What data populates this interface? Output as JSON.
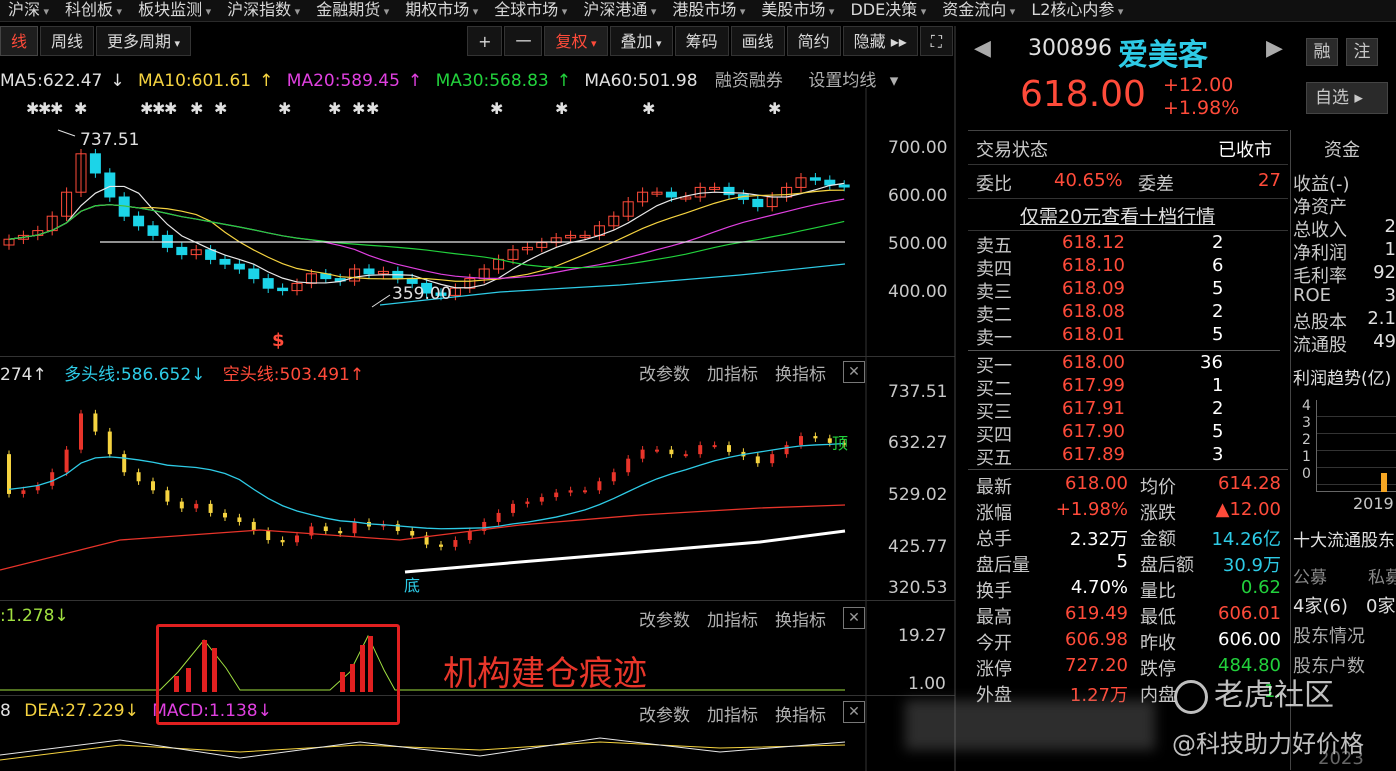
{
  "topnav": [
    "沪深",
    "科创板",
    "板块监测",
    "沪深指数",
    "金融期货",
    "期权市场",
    "全球市场",
    "沪深港通",
    "港股市场",
    "美股市场",
    "DDE决策",
    "资金流向",
    "L2核心内参"
  ],
  "toolbar": {
    "items": [
      "线",
      "周线",
      "更多周期",
      "+",
      "一",
      "复权",
      "叠加",
      "筹码",
      "画线",
      "简约",
      "隐藏"
    ],
    "expand_icon": "expand-icon"
  },
  "ma": {
    "ma5": "MA5:622.47",
    "ma10": "MA10:601.61",
    "ma20": "MA20:589.45",
    "ma30": "MA30:568.83",
    "ma60": "MA60:501.98",
    "margin": "融资融券",
    "settings": "设置均线"
  },
  "main_chart": {
    "high_label": "737.51",
    "low_label": "359.00",
    "dollar": "$",
    "y_labels": [
      "700.00",
      "600.00",
      "500.00",
      "400.00"
    ],
    "stars": [
      "✱✱✱ ✱",
      "✱✱✱ ✱ ✱",
      "✱",
      "✱",
      "✱ ✱✱",
      "✱",
      "✱",
      "✱",
      "✱"
    ]
  },
  "panel2": {
    "left": "274",
    "long_line": "多头线:586.652",
    "short_line": "空头线:503.491",
    "y_labels": [
      "737.51",
      "632.27",
      "529.02",
      "425.77",
      "320.53"
    ],
    "top_mark": "顶",
    "bottom_mark": "底"
  },
  "panel3": {
    "value": ":1.278",
    "y_labels": [
      "19.27",
      "1.00"
    ]
  },
  "panel4": {
    "left": "8",
    "dea": "DEA:27.229",
    "macd": "MACD:1.138"
  },
  "panel_buttons": {
    "params": "改参数",
    "add": "加指标",
    "swap": "换指标",
    "close": "✕"
  },
  "annotation": "机构建仓痕迹",
  "stock": {
    "code": "300896",
    "name": "爱美客",
    "price": "618.00",
    "change": "+12.00",
    "change_pct": "+1.98%",
    "btn_margin": "融",
    "btn_note": "注",
    "btn_watch": "自选"
  },
  "status": {
    "label": "交易状态",
    "value": "已收市"
  },
  "commission": {
    "ratio_label": "委比",
    "ratio": "40.65%",
    "diff_label": "委差",
    "diff": "27"
  },
  "promo": "仅需20元查看十档行情",
  "asks": [
    {
      "label": "卖五",
      "price": "618.12",
      "vol": "2"
    },
    {
      "label": "卖四",
      "price": "618.10",
      "vol": "6"
    },
    {
      "label": "卖三",
      "price": "618.09",
      "vol": "5"
    },
    {
      "label": "卖二",
      "price": "618.08",
      "vol": "2"
    },
    {
      "label": "卖一",
      "price": "618.01",
      "vol": "5"
    }
  ],
  "bids": [
    {
      "label": "买一",
      "price": "618.00",
      "vol": "36"
    },
    {
      "label": "买二",
      "price": "617.99",
      "vol": "1"
    },
    {
      "label": "买三",
      "price": "617.91",
      "vol": "2"
    },
    {
      "label": "买四",
      "price": "617.90",
      "vol": "5"
    },
    {
      "label": "买五",
      "price": "617.89",
      "vol": "3"
    }
  ],
  "quote": [
    {
      "l1": "最新",
      "v1": "618.00",
      "l2": "均价",
      "v2": "614.28"
    },
    {
      "l1": "涨幅",
      "v1": "+1.98%",
      "l2": "涨跌",
      "v2": "▲12.00"
    },
    {
      "l1": "总手",
      "v1": "2.32万",
      "l2": "金额",
      "v2": "14.26亿"
    },
    {
      "l1": "盘后量",
      "v1": "5",
      "l2": "盘后额",
      "v2": "30.9万"
    },
    {
      "l1": "换手",
      "v1": "4.70%",
      "l2": "量比",
      "v2": "0.62"
    },
    {
      "l1": "最高",
      "v1": "619.49",
      "l2": "最低",
      "v2": "606.01"
    },
    {
      "l1": "今开",
      "v1": "606.98",
      "l2": "昨收",
      "v2": "606.00"
    },
    {
      "l1": "涨停",
      "v1": "727.20",
      "l2": "跌停",
      "v2": "484.80"
    },
    {
      "l1": "外盘",
      "v1": "1.27万",
      "l2": "内盘",
      "v2": "1."
    }
  ],
  "sidebar": {
    "fund_tab": "资金",
    "items": [
      "收益(-)",
      "净资产",
      "总收入",
      "净利润",
      "毛利率",
      "ROE",
      "总股本",
      "流通股"
    ],
    "values": [
      "",
      "",
      "2",
      "1",
      "92",
      "3",
      "2.1",
      "49"
    ],
    "trend_title": "利润趋势(亿)",
    "trend_ticks": [
      "4",
      "3",
      "2",
      "1",
      "0"
    ],
    "trend_year": "2019",
    "holders_title": "十大流通股东",
    "fund_public": "公募",
    "fund_private": "私募",
    "fund_public_val": "4家(6)",
    "fund_private_val": "0家",
    "holder_status": "股东情况",
    "holder_count": "股东户数"
  },
  "watermarks": {
    "tiger": "老虎社区",
    "author": "@科技助力好价格",
    "bottom_year": "2023"
  },
  "colors": {
    "red": "#ff4b3a",
    "green": "#22d13c",
    "cyan": "#2ecbe6",
    "yellow": "#f5d340",
    "magenta": "#e040e0",
    "annotation": "#e02020"
  }
}
